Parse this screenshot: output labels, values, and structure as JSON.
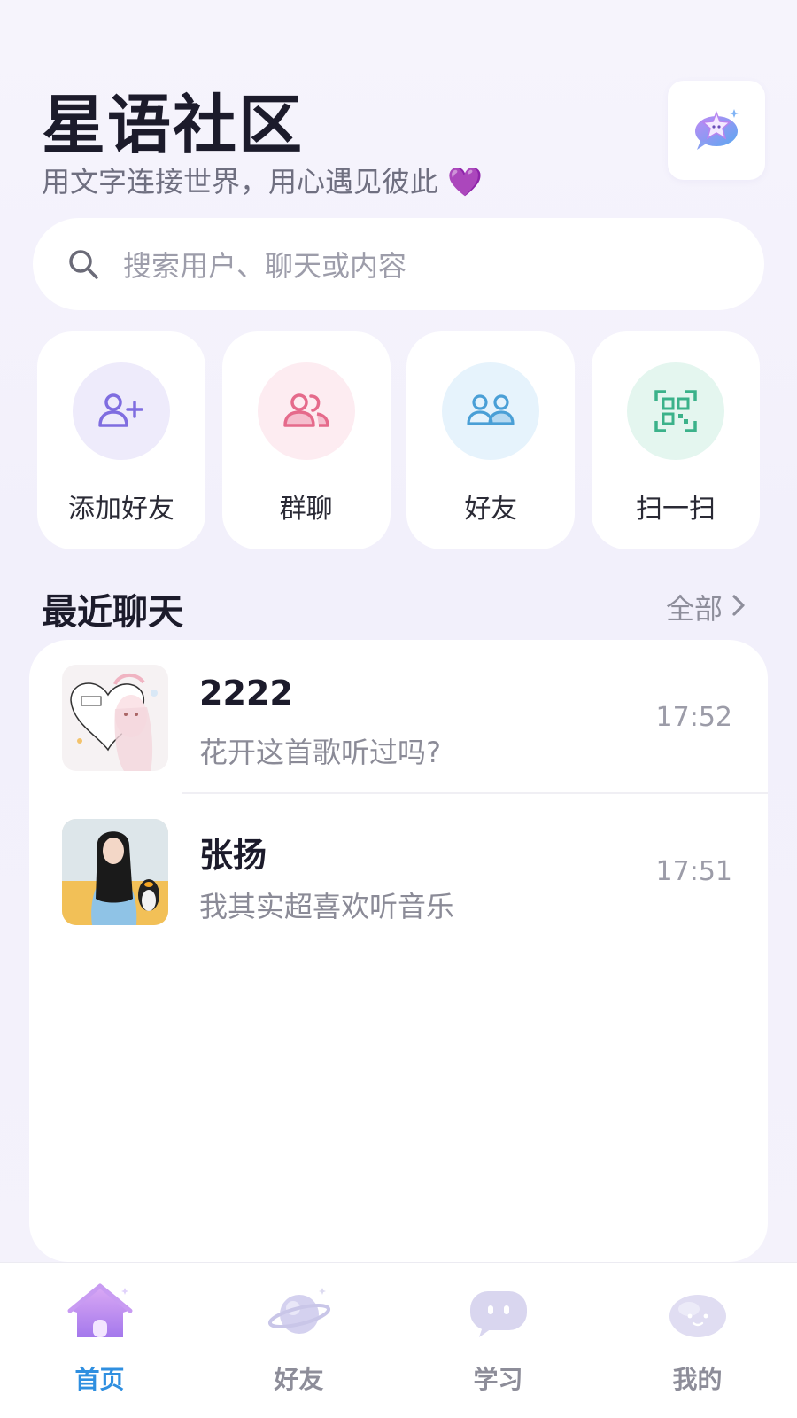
{
  "header": {
    "title": "星语社区",
    "subtitle": "用文字连接世界，用心遇见彼此 💜",
    "logo_icon": "star-chat-icon"
  },
  "search": {
    "placeholder": "搜索用户、聊天或内容"
  },
  "quick_actions": [
    {
      "label": "添加好友",
      "icon": "add-user-icon",
      "color": "#7f6de0",
      "bg": "#eeebfb"
    },
    {
      "label": "群聊",
      "icon": "group-chat-icon",
      "color": "#e56a8b",
      "bg": "#fdecf1"
    },
    {
      "label": "好友",
      "icon": "friends-icon",
      "color": "#4a9fd6",
      "bg": "#e6f3fc"
    },
    {
      "label": "扫一扫",
      "icon": "scan-qr-icon",
      "color": "#3bb28a",
      "bg": "#e4f6ef"
    }
  ],
  "recent": {
    "title": "最近聊天",
    "view_all": "全部"
  },
  "chats": [
    {
      "name": "2222",
      "preview": "花开这首歌听过吗?",
      "time": "17:52"
    },
    {
      "name": "张扬",
      "preview": "我其实超喜欢听音乐",
      "time": "17:51"
    }
  ],
  "nav": [
    {
      "label": "首页",
      "icon": "home-icon",
      "active": true
    },
    {
      "label": "好友",
      "icon": "planet-icon",
      "active": false
    },
    {
      "label": "学习",
      "icon": "chat-bubble-icon",
      "active": false
    },
    {
      "label": "我的",
      "icon": "profile-cloud-icon",
      "active": false
    }
  ],
  "colors": {
    "accent": "#2f8fe0",
    "title": "#1c1b2b",
    "muted": "#8b8b97"
  }
}
